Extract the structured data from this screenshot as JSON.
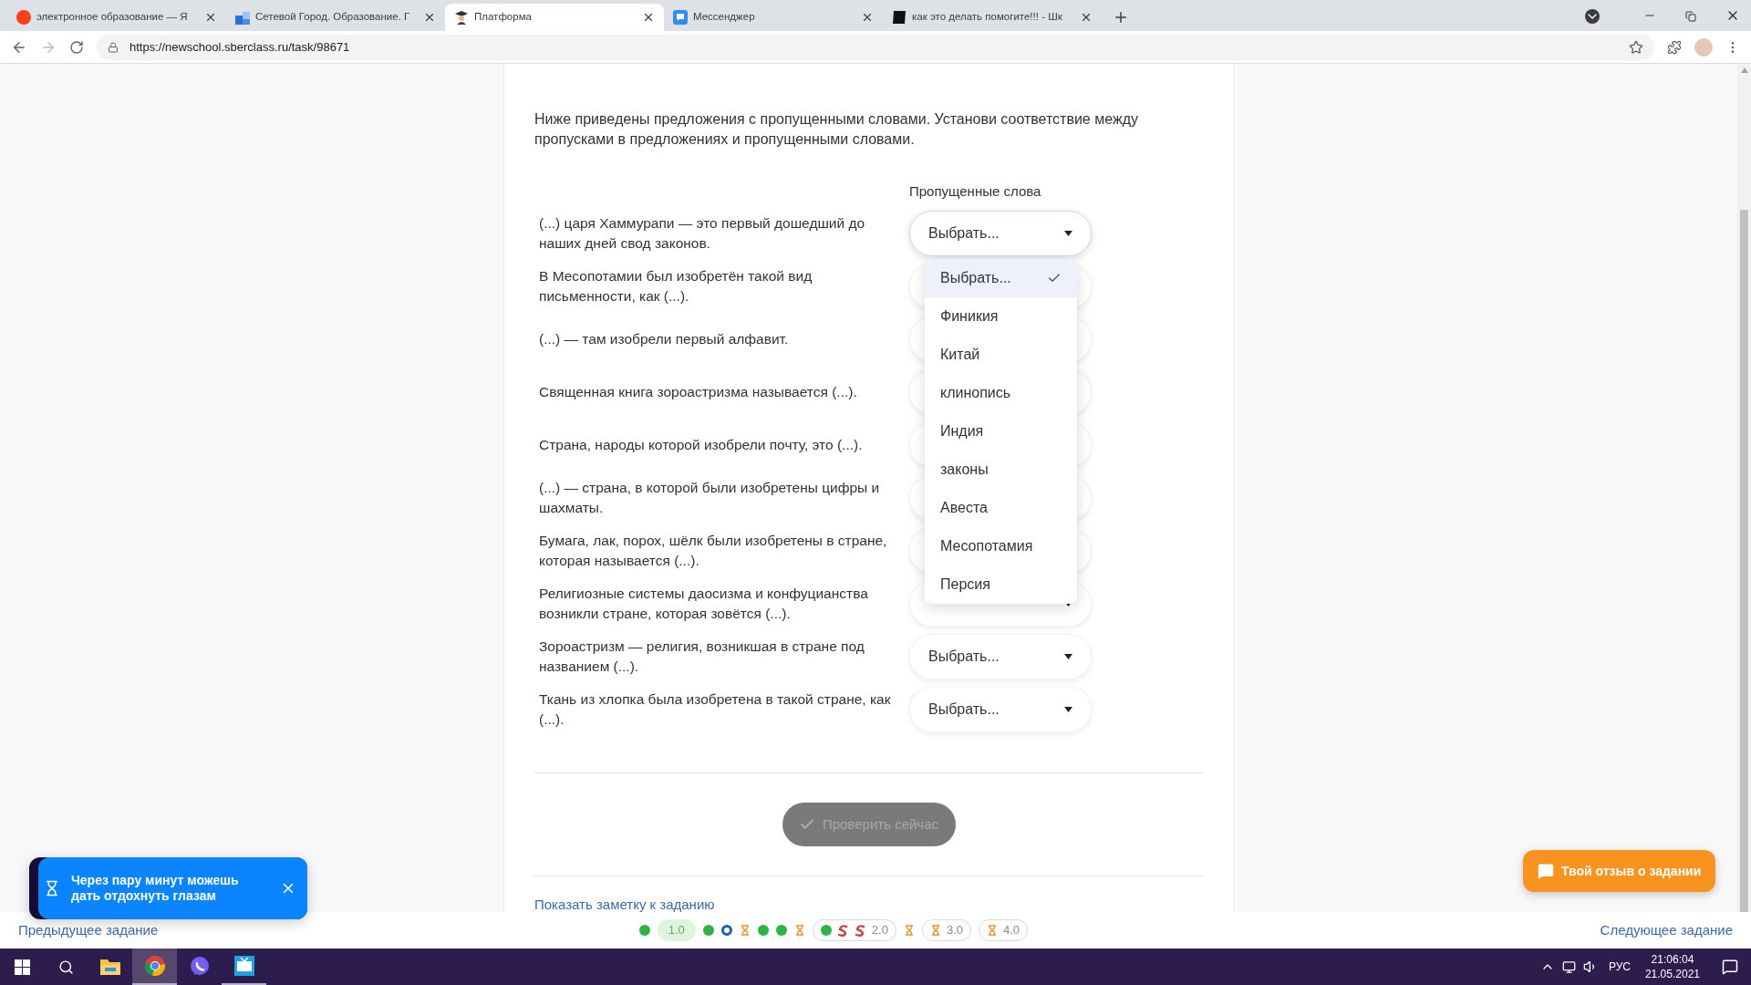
{
  "browser": {
    "tabs": [
      {
        "title": "электронное образование — Я",
        "selected": false
      },
      {
        "title": "Сетевой Город. Образование. Г",
        "selected": false
      },
      {
        "title": "Платформа",
        "selected": true
      },
      {
        "title": "Мессенджер",
        "selected": false
      },
      {
        "title": "как это делать помогите!!! - Шк",
        "selected": false
      }
    ],
    "url": "https://newschool.sberclass.ru/task/98671"
  },
  "task": {
    "instruction": "Ниже приведены предложения с пропущенными словами. Установи соответствие между пропусками в предложениях и пропущенными словами.",
    "column_header": "Пропущенные слова",
    "rows": [
      {
        "text": "(...) царя Хаммурапи — это первый дошедший до наших дней свод законов.",
        "value": "Выбрать...",
        "open": true,
        "options": [
          {
            "label": "Выбрать...",
            "selected": true
          },
          {
            "label": "Финикия",
            "selected": false
          },
          {
            "label": "Китай",
            "selected": false
          },
          {
            "label": "клинопись",
            "selected": false
          },
          {
            "label": "Индия",
            "selected": false
          },
          {
            "label": "законы",
            "selected": false
          },
          {
            "label": "Авеста",
            "selected": false
          },
          {
            "label": "Месопотамия",
            "selected": false
          },
          {
            "label": "Персия",
            "selected": false
          }
        ]
      },
      {
        "text": "В Месопотамии был изобретён такой вид письменности, как (...).",
        "open": false
      },
      {
        "text": "(...) — там изобрели первый алфавит.",
        "open": false
      },
      {
        "text": "Священная книга зороастризма называется (...).",
        "open": false
      },
      {
        "text": "Страна, народы которой изобрели почту, это (...).",
        "open": false
      },
      {
        "text": "(...) — страна, в которой были изобретены цифры и шахматы.",
        "open": false
      },
      {
        "text": "Бумага, лак, порох, шёлк были изобретены в стране, которая называется (...).",
        "open": false
      },
      {
        "text": "Религиозные системы даосизма и конфуцианства возникли стране, которая зовётся (...).",
        "open": false
      },
      {
        "text": "Зороастризм — религия, возникшая в стране под названием (...).",
        "value": "Выбрать...",
        "open": false
      },
      {
        "text": "Ткань из хлопка была изобретена в такой стране, как (...).",
        "value": "Выбрать...",
        "open": false
      }
    ],
    "check_button": {
      "label": "Проверить сейчас",
      "disabled": true
    },
    "note_link": "Показать заметку к заданию"
  },
  "toast": {
    "text": "Через пару минут можешь дать отдохнуть глазам"
  },
  "feedback_button": "Твой отзыв о задании",
  "footer": {
    "prev": "Предыдущее задание",
    "next": "Следующее задание",
    "progress": [
      {
        "kind": "done"
      },
      {
        "kind": "badge",
        "label": "1.0"
      },
      {
        "kind": "done"
      },
      {
        "kind": "current"
      },
      {
        "kind": "pending"
      },
      {
        "kind": "done"
      },
      {
        "kind": "done"
      },
      {
        "kind": "pending"
      },
      {
        "kind": "group",
        "label": "2.0",
        "children": [
          {
            "kind": "done"
          },
          {
            "kind": "failed"
          },
          {
            "kind": "failed"
          }
        ]
      },
      {
        "kind": "pending"
      },
      {
        "kind": "group",
        "label": "3.0",
        "children": [
          {
            "kind": "pending"
          }
        ]
      },
      {
        "kind": "group",
        "label": "4.0",
        "children": [
          {
            "kind": "pending"
          }
        ]
      }
    ]
  },
  "taskbar": {
    "apps": [
      {
        "selected": false,
        "running": false
      },
      {
        "selected": true,
        "running": true
      },
      {
        "selected": false,
        "running": false
      },
      {
        "selected": false,
        "running": true
      }
    ],
    "language": "РУС",
    "time": "21:06:04",
    "date": "21.05.2021"
  }
}
